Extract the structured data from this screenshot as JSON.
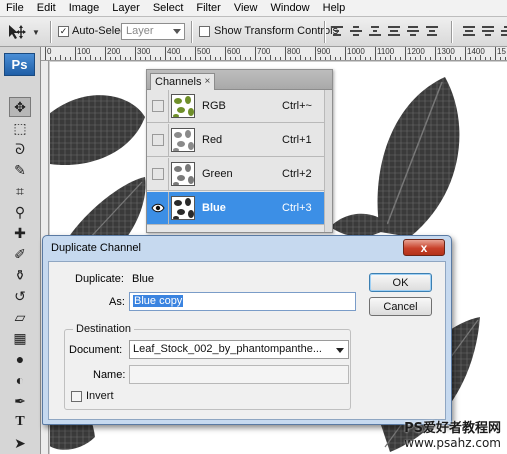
{
  "menu": [
    "File",
    "Edit",
    "Image",
    "Layer",
    "Select",
    "Filter",
    "View",
    "Window",
    "Help"
  ],
  "options_bar": {
    "auto_select_label": "Auto-Select:",
    "auto_select_checked": true,
    "layer_select_value": "Layer",
    "show_transform_label": "Show Transform Controls",
    "show_transform_checked": false
  },
  "toolbox": {
    "logo": "Ps",
    "tools": [
      "move-icon",
      "marquee-icon",
      "lasso-icon",
      "quick-select-icon",
      "crop-icon",
      "eyedropper-icon",
      "healing-brush-icon",
      "brush-icon",
      "clone-stamp-icon",
      "history-brush-icon",
      "eraser-icon",
      "gradient-icon",
      "blur-icon",
      "dodge-icon",
      "pen-icon",
      "type-icon",
      "path-select-icon"
    ]
  },
  "ruler": {
    "labels": [
      "0",
      "100",
      "200",
      "300",
      "400",
      "500",
      "600",
      "700",
      "800",
      "900",
      "1000",
      "1100",
      "1200",
      "1300",
      "1400",
      "15"
    ]
  },
  "channels_panel": {
    "tab_label": "Channels",
    "close_glyph": "×",
    "rows": [
      {
        "name": "RGB",
        "shortcut": "Ctrl+~",
        "visible": false,
        "selected": false
      },
      {
        "name": "Red",
        "shortcut": "Ctrl+1",
        "visible": false,
        "selected": false
      },
      {
        "name": "Green",
        "shortcut": "Ctrl+2",
        "visible": false,
        "selected": false
      },
      {
        "name": "Blue",
        "shortcut": "Ctrl+3",
        "visible": true,
        "selected": true
      }
    ]
  },
  "dialog": {
    "title": "Duplicate Channel",
    "close_glyph": "x",
    "duplicate_label": "Duplicate:",
    "duplicate_value": "Blue",
    "as_label": "As:",
    "as_value": "Blue copy",
    "ok_label": "OK",
    "cancel_label": "Cancel",
    "destination_legend": "Destination",
    "document_label": "Document:",
    "document_value": "Leaf_Stock_002_by_phantompanthe...",
    "name_label": "Name:",
    "name_value": "",
    "invert_label": "Invert",
    "invert_checked": false
  },
  "watermark": {
    "line1": "PS爱好者教程网",
    "line2": "www.psahz.com"
  }
}
